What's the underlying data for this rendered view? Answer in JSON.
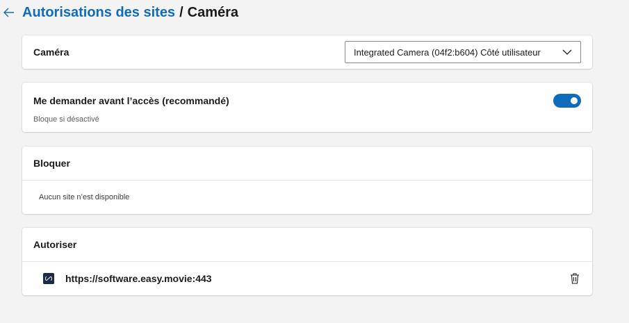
{
  "header": {
    "breadcrumb_parent": "Autorisations des sites",
    "breadcrumb_sep": "/",
    "breadcrumb_current": "Caméra"
  },
  "camera": {
    "label": "Caméra",
    "selected_device": "Integrated Camera (04f2:b604) Côté utilisateur"
  },
  "ask": {
    "label": "Me demander avant l’accès (recommandé)",
    "sublabel": "Bloque si désactivé",
    "enabled": true
  },
  "block": {
    "title": "Bloquer",
    "empty_text": "Aucun site n’est disponible"
  },
  "allow": {
    "title": "Autoriser",
    "sites": [
      {
        "url": "https://software.easy.movie:443"
      }
    ]
  },
  "colors": {
    "accent": "#0f6cbd",
    "background": "#f3f3f3",
    "card": "#ffffff"
  }
}
